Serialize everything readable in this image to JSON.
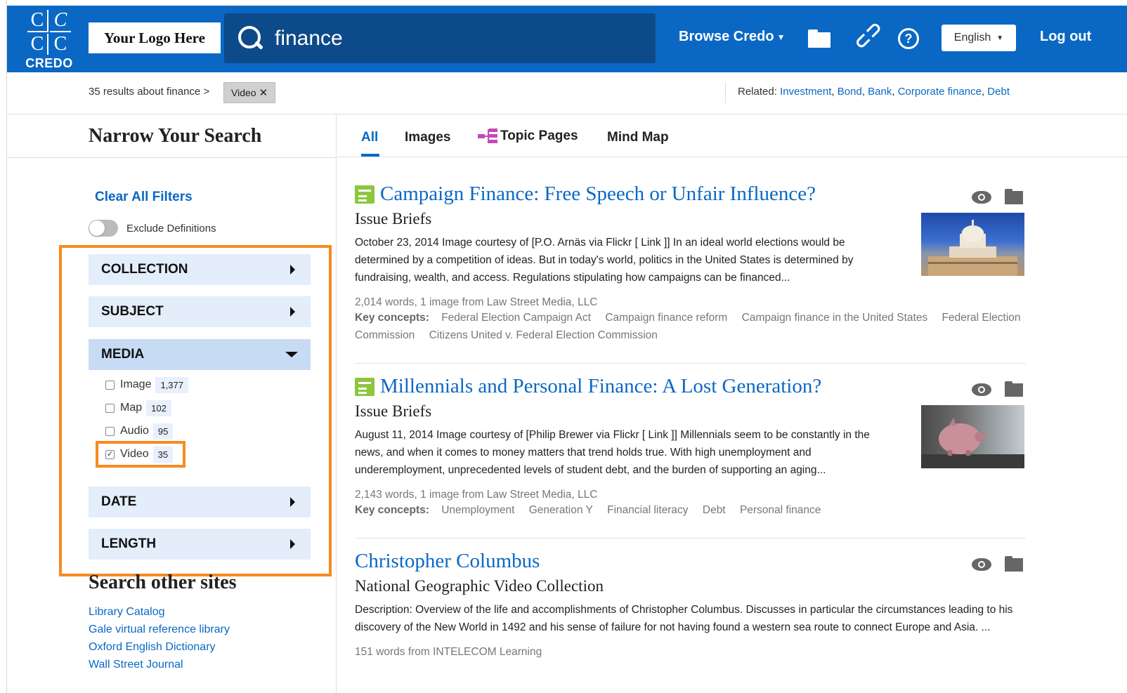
{
  "header": {
    "brand": "CREDO",
    "logo_letters": [
      "C",
      "C",
      "C",
      "C"
    ],
    "your_logo": "Your Logo Here",
    "search_value": "finance",
    "browse_label": "Browse Credo",
    "language": "English",
    "logout_label": "Log out",
    "colors": {
      "brand_blue": "#0a68c4",
      "search_bg": "#0d4a8a",
      "highlight": "#f68b1f"
    }
  },
  "results_bar": {
    "count_text": "35 results about finance >",
    "filter_chip": "Video",
    "related_label": "Related:",
    "related_links": [
      "Investment",
      "Bond",
      "Bank",
      "Corporate finance",
      "Debt"
    ]
  },
  "sidebar": {
    "title": "Narrow Your Search",
    "clear_filters": "Clear All Filters",
    "exclude_definitions": "Exclude Definitions",
    "facets": {
      "collection": "COLLECTION",
      "subject": "SUBJECT",
      "media": "MEDIA",
      "date": "DATE",
      "length": "LENGTH"
    },
    "media_options": [
      {
        "label": "Image",
        "count": "1,377",
        "checked": false
      },
      {
        "label": "Map",
        "count": "102",
        "checked": false
      },
      {
        "label": "Audio",
        "count": "95",
        "checked": false
      },
      {
        "label": "Video",
        "count": "35",
        "checked": true
      }
    ],
    "other_sites_title": "Search other sites",
    "other_sites": [
      "Library Catalog",
      "Gale virtual reference library",
      "Oxford English Dictionary",
      "Wall Street Journal"
    ]
  },
  "tabs": {
    "all": "All",
    "images": "Images",
    "topic_pages": "Topic Pages",
    "mind_map": "Mind Map"
  },
  "results": [
    {
      "title": "Campaign Finance: Free Speech or Unfair Influence?",
      "source": "Issue Briefs",
      "description": "October 23, 2014 Image courtesy of [P.O. Arnäs via Flickr [ Link ]] In an ideal world elections would be determined by a competition of ideas. But in today's world, politics in the United States is determined by fundraising, wealth, and access. Regulations stipulating how campaigns can be financed...",
      "meta": "2,014 words, 1 image from Law Street Media, LLC",
      "key_concepts_label": "Key concepts:",
      "key_concepts": [
        "Federal Election Campaign Act",
        "Campaign finance reform",
        "Campaign finance in the United States",
        "Federal Election Commission",
        "Citizens United v. Federal Election Commission"
      ]
    },
    {
      "title": "Millennials and Personal Finance: A Lost Generation?",
      "source": "Issue Briefs",
      "description": "August 11, 2014 Image courtesy of [Philip Brewer via Flickr [ Link ]] Millennials seem to be constantly in the news, and when it comes to money matters that trend holds true. With high unemployment and underemployment, unprecedented levels of student debt, and the burden of supporting an aging...",
      "meta": "2,143 words, 1 image from Law Street Media, LLC",
      "key_concepts_label": "Key concepts:",
      "key_concepts": [
        "Unemployment",
        "Generation Y",
        "Financial literacy",
        "Debt",
        "Personal finance"
      ]
    },
    {
      "title": "Christopher Columbus",
      "source": "National Geographic Video Collection",
      "description": "Description: Overview of the life and accomplishments of Christopher Columbus. Discusses in particular the circumstances leading to his discovery of the New World in 1492 and his sense of failure for not having found a western sea route to connect Europe and Asia. ...",
      "meta": "151 words from INTELECOM Learning"
    }
  ]
}
